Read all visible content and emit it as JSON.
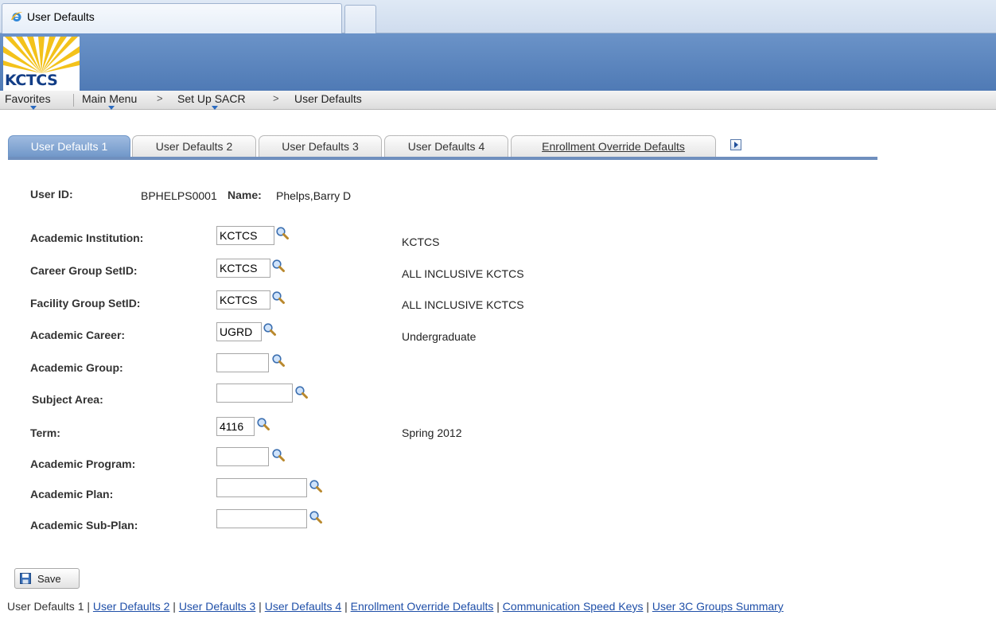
{
  "browser": {
    "tab_title": "User Defaults"
  },
  "banner": {
    "logo_text": "KCTCS"
  },
  "nav": {
    "favorites": "Favorites",
    "main_menu": "Main Menu",
    "sep": ">",
    "set_up": "Set Up SACR",
    "current": "User Defaults"
  },
  "tabs": [
    {
      "label": "User Defaults 1"
    },
    {
      "label": "User Defaults 2"
    },
    {
      "label": "User Defaults 3"
    },
    {
      "label": "User Defaults 4"
    },
    {
      "label": "Enrollment Override Defaults"
    }
  ],
  "header": {
    "user_id_label": "User ID:",
    "user_id_value": "BPHELPS0001",
    "name_label": "Name:",
    "name_value": "Phelps,Barry D"
  },
  "fields": [
    {
      "label": "Academic Institution:",
      "value": "KCTCS",
      "description": "KCTCS"
    },
    {
      "label": "Career Group SetID:",
      "value": "KCTCS",
      "description": "ALL INCLUSIVE KCTCS"
    },
    {
      "label": "Facility Group SetID:",
      "value": "KCTCS",
      "description": "ALL INCLUSIVE KCTCS"
    },
    {
      "label": "Academic Career:",
      "value": "UGRD",
      "description": "Undergraduate"
    },
    {
      "label": "Academic Group:",
      "value": "",
      "description": ""
    },
    {
      "label": "Subject Area:",
      "value": "",
      "description": ""
    },
    {
      "label": "Term:",
      "value": "4116",
      "description": "Spring 2012"
    },
    {
      "label": "Academic Program:",
      "value": "",
      "description": ""
    },
    {
      "label": "Academic Plan:",
      "value": "",
      "description": ""
    },
    {
      "label": "Academic Sub-Plan:",
      "value": "",
      "description": ""
    }
  ],
  "save_label": "Save",
  "links": {
    "current": "User Defaults 1",
    "sep": " | ",
    "items": [
      "User Defaults 2",
      "User Defaults 3",
      "User Defaults 4",
      "Enrollment Override Defaults",
      "Communication Speed Keys",
      "User 3C Groups Summary"
    ]
  }
}
